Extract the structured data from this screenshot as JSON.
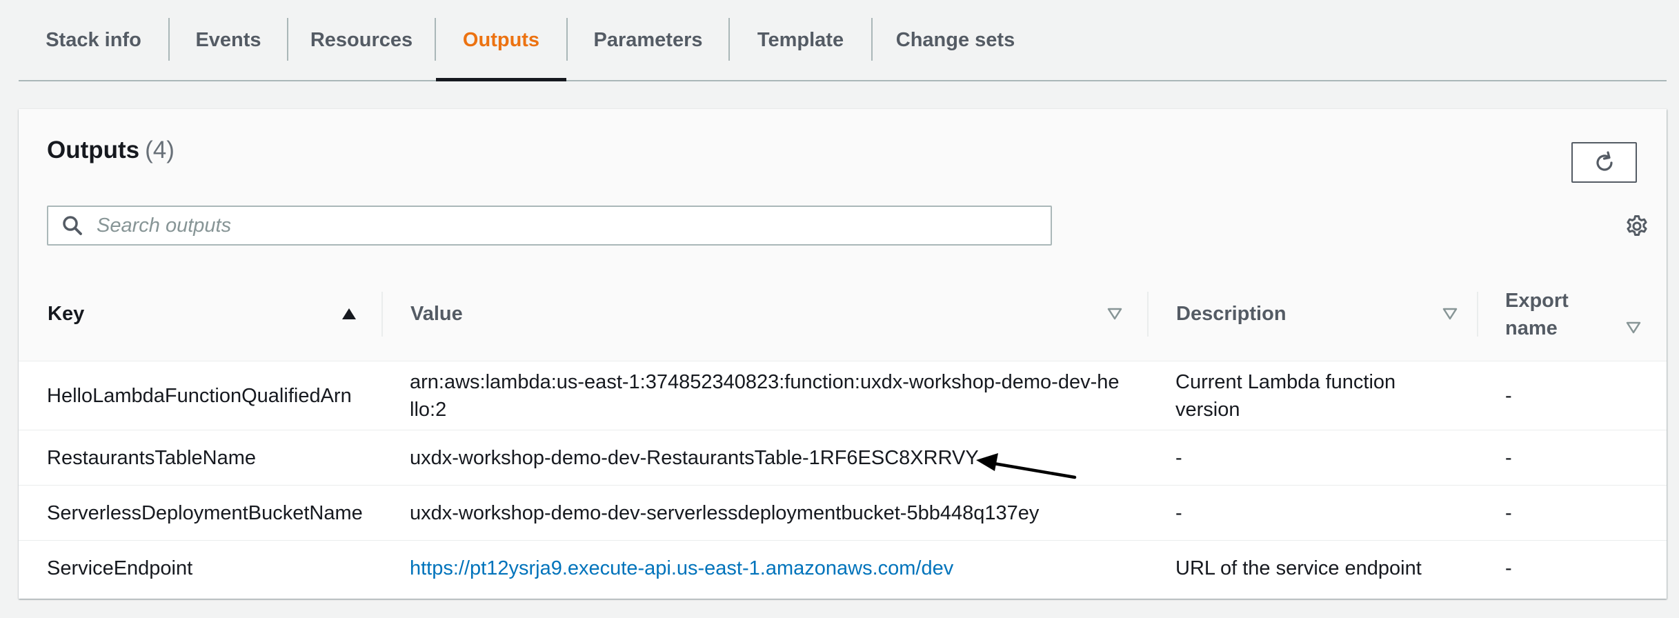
{
  "tabs": [
    {
      "label": "Stack info",
      "active": false
    },
    {
      "label": "Events",
      "active": false
    },
    {
      "label": "Resources",
      "active": false
    },
    {
      "label": "Outputs",
      "active": true
    },
    {
      "label": "Parameters",
      "active": false
    },
    {
      "label": "Template",
      "active": false
    },
    {
      "label": "Change sets",
      "active": false
    }
  ],
  "panel": {
    "title": "Outputs",
    "count": "(4)",
    "refresh_icon": "refresh-icon",
    "settings_icon": "gear-icon"
  },
  "search": {
    "placeholder": "Search outputs",
    "value": "",
    "icon": "search-icon"
  },
  "table": {
    "columns": [
      {
        "label": "Key",
        "sort": "ascending"
      },
      {
        "label": "Value",
        "sort": "none"
      },
      {
        "label": "Description",
        "sort": "none"
      },
      {
        "label": "Export name",
        "sort": "none"
      }
    ],
    "rows": [
      {
        "key": "HelloLambdaFunctionQualifiedArn",
        "value": "arn:aws:lambda:us-east-1:374852340823:function:uxdx-workshop-demo-dev-hello:2",
        "description": "Current Lambda function version",
        "export_name": "-"
      },
      {
        "key": "RestaurantsTableName",
        "value": "uxdx-workshop-demo-dev-RestaurantsTable-1RF6ESC8XRRVY",
        "description": "-",
        "export_name": "-"
      },
      {
        "key": "ServerlessDeploymentBucketName",
        "value": "uxdx-workshop-demo-dev-serverlessdeploymentbucket-5bb448q137ey",
        "description": "-",
        "export_name": "-"
      },
      {
        "key": "ServiceEndpoint",
        "value": "https://pt12ysrja9.execute-api.us-east-1.amazonaws.com/dev",
        "description": "URL of the service endpoint",
        "export_name": "-",
        "value_is_link": true
      }
    ]
  },
  "colors": {
    "active_tab": "#ec7211",
    "link": "#0073bb",
    "text": "#16191f",
    "muted": "#545b64"
  }
}
